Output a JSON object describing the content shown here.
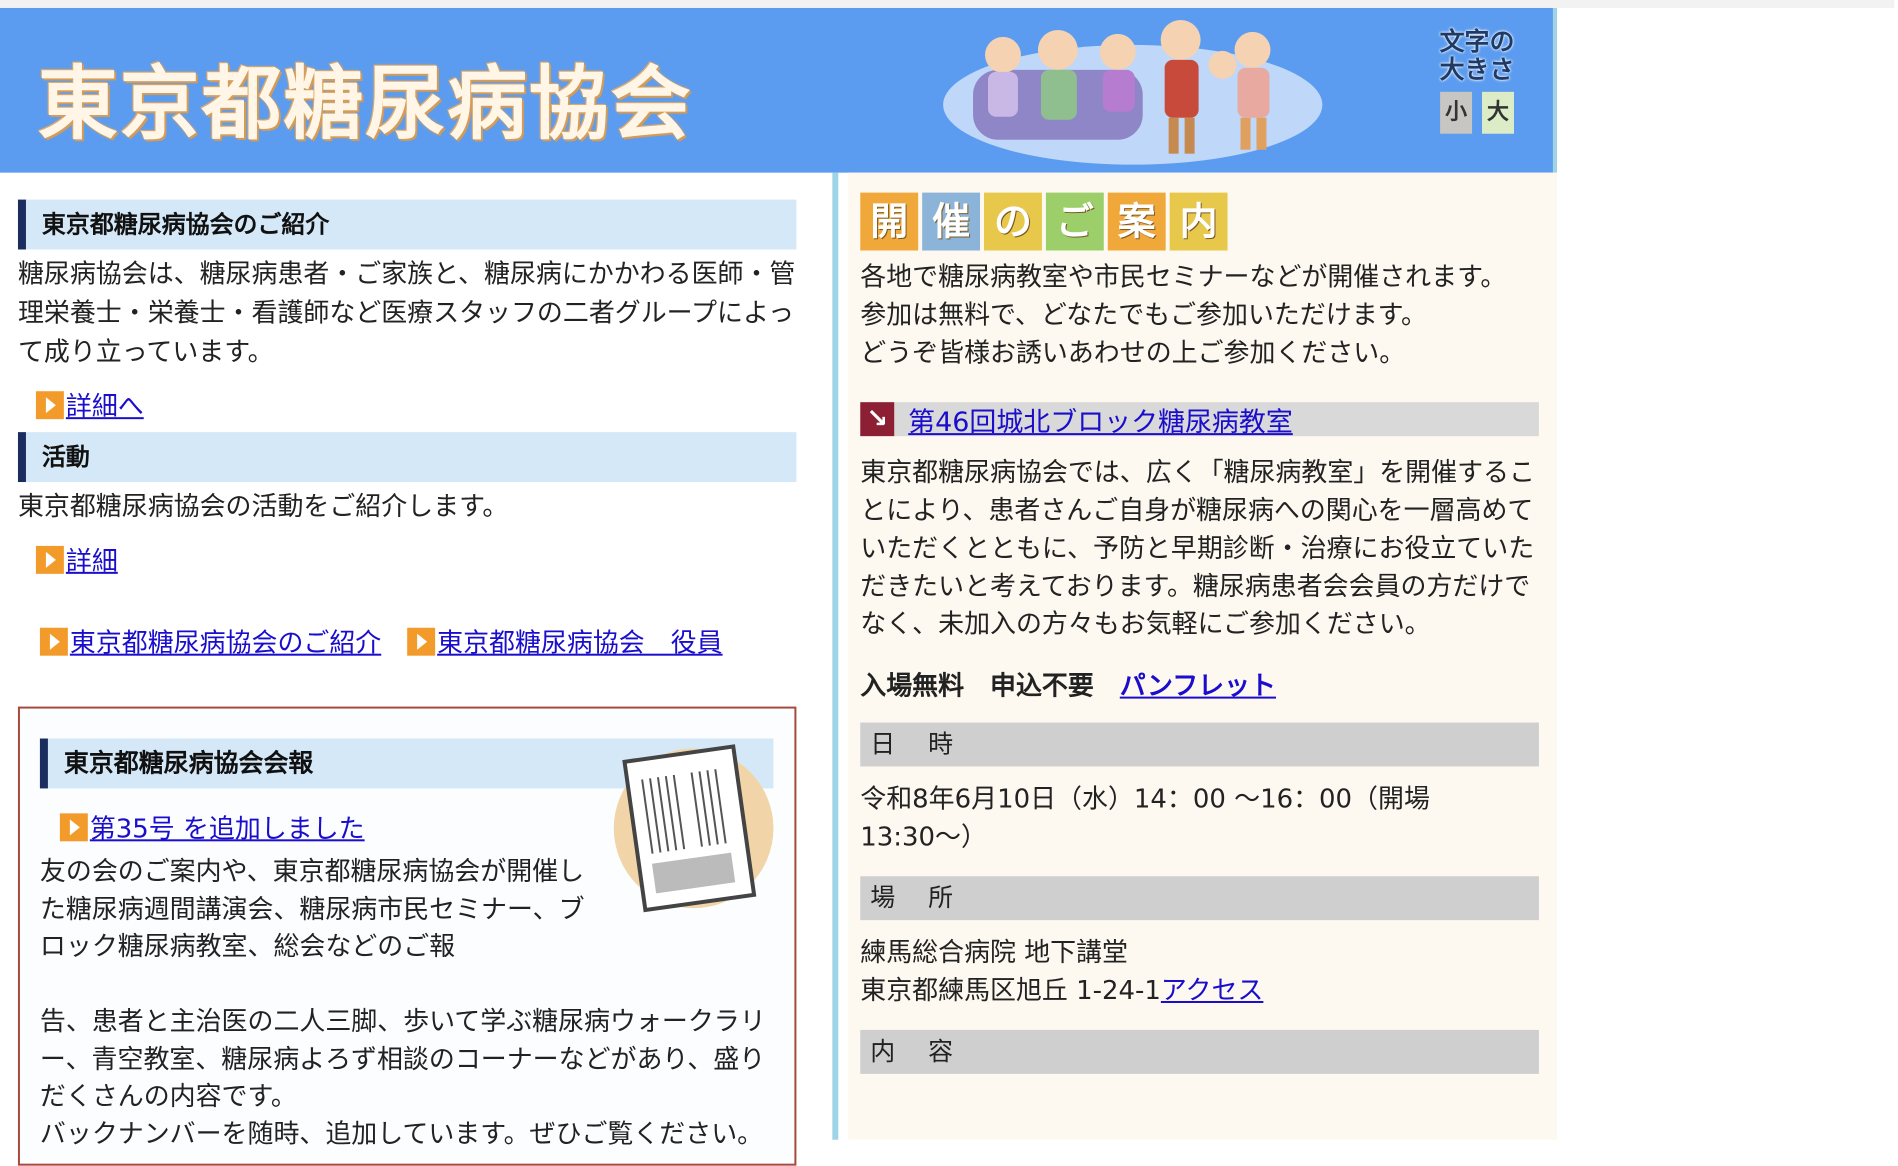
{
  "header": {
    "logo": "東京都糖尿病協会",
    "font_size_label_line1": "文字の",
    "font_size_label_line2": "大きさ",
    "font_small": "小",
    "font_large": "大"
  },
  "intro": {
    "heading": "東京都糖尿病協会のご紹介",
    "text": "糖尿病協会は、糖尿病患者・ご家族と、糖尿病にかかわる医師・管理栄養士・栄養士・看護師など医療スタッフの二者グループによって成り立っています。",
    "link": "詳細へ"
  },
  "activity": {
    "heading": "活動",
    "text": "東京都糖尿病協会の活動をご紹介します。",
    "link": "詳細"
  },
  "sublinks": [
    "東京都糖尿病協会のご紹介",
    "東京都糖尿病協会　役員"
  ],
  "bulletin": {
    "heading": "東京都糖尿病協会会報",
    "link": "第35号 を追加しました",
    "text1": "友の会のご案内や、東京都糖尿病協会が開催した糖尿病週間講演会、糖尿病市民セミナー、ブロック糖尿病教室、総会などのご報",
    "text2": "告、患者と主治医の二人三脚、歩いて学ぶ糖尿病ウォークラリー、青空教室、糖尿病よろず相談のコーナーなどがあり、盛りだくさんの内容です。",
    "text3": "バックナンバーを随時、追加しています。ぜひご覧ください。"
  },
  "events": {
    "title_chars": [
      "開",
      "催",
      "の",
      "ご",
      "案",
      "内"
    ],
    "title_colors": [
      "#f0a83a",
      "#8cb4d8",
      "#e8c84a",
      "#9ccf6a",
      "#f0a83a",
      "#e8c84a"
    ],
    "intro1": "各地で糖尿病教室や市民セミナーなどが開催されます。",
    "intro2": "参加は無料で、どなたでもご参加いただけます。",
    "intro3": "どうぞ皆様お誘いあわせの上ご参加ください。",
    "event_title": "第46回城北ブロック糖尿病教室",
    "description": "東京都糖尿病協会では、広く「糖尿病教室」を開催することにより、患者さんご自身が糖尿病への関心を一層高めていただくとともに、予防と早期診断・治療にお役立ていただきたいと考えております。糖尿病患者会会員の方だけでなく、未加入の方々もお気軽にご参加ください。",
    "free_entry": "入場無料",
    "no_application": "申込不要",
    "pamphlet": "パンフレット",
    "date_label": "日　時",
    "date_value": "令和8年6月10日（水）14：00 〜16：00（開場13:30〜）",
    "place_label": "場　所",
    "place_name": "練馬総合病院 地下講堂",
    "place_address": "東京都練馬区旭丘 1-24-1",
    "access": "アクセス",
    "content_label": "内　容"
  }
}
